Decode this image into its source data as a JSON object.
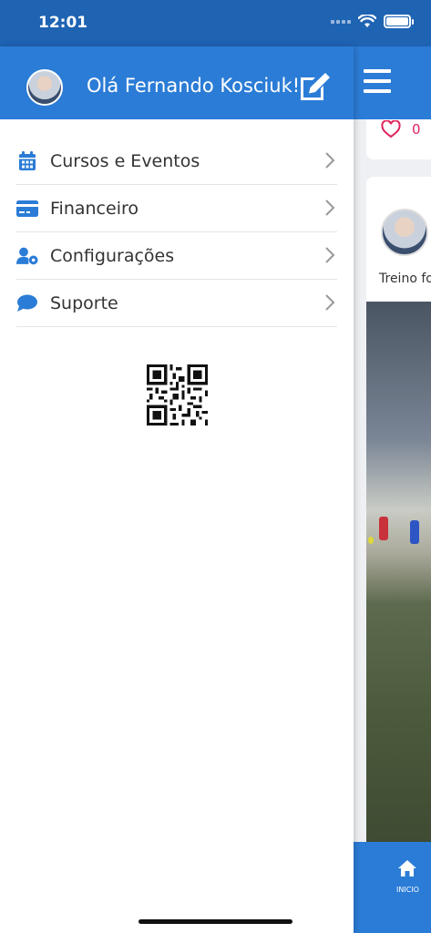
{
  "status_bar": {
    "time": "12:01",
    "icons": [
      "signal-icon",
      "wifi-icon",
      "battery-icon"
    ]
  },
  "drawer": {
    "greeting": "Olá Fernando Kosciuk!",
    "avatar_icon": "user-avatar",
    "edit_icon": "edit-icon",
    "menu": [
      {
        "label": "Cursos e Eventos",
        "icon": "calendar-icon"
      },
      {
        "label": "Financeiro",
        "icon": "credit-card-icon"
      },
      {
        "label": "Configurações",
        "icon": "user-settings-icon"
      },
      {
        "label": "Suporte",
        "icon": "chat-bubble-icon"
      }
    ],
    "qr_icon": "qr-code-icon"
  },
  "feed": {
    "likes": "0",
    "post_text": "Treino fo",
    "bottom_tab_label": "INICIO",
    "bottom_tab_icon": "home-icon"
  },
  "colors": {
    "primary": "#2b7cd6",
    "status_bar": "#1f63b3",
    "like": "#e0245e",
    "text": "#333333"
  }
}
